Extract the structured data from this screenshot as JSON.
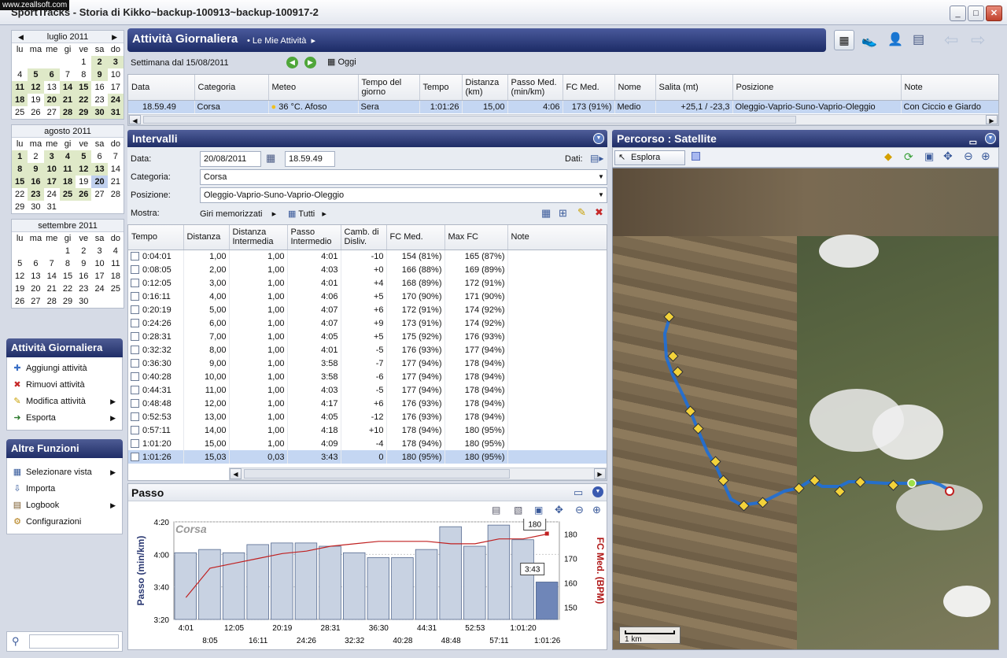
{
  "window": {
    "watermark": "www.zeallsoft.com",
    "title": "SportTracks - Storia di Kikko~backup-100913~backup-100917-2"
  },
  "calendar": {
    "weekdays": [
      "lu",
      "ma",
      "me",
      "gi",
      "ve",
      "sa",
      "do"
    ],
    "months": [
      {
        "name": "luglio 2011",
        "cells": [
          "",
          "",
          "",
          "",
          "1",
          "2",
          "3",
          "4",
          "5",
          "6",
          "7",
          "8",
          "9",
          "10",
          "11",
          "12",
          "13",
          "14",
          "15",
          "16",
          "17",
          "18",
          "19",
          "20",
          "21",
          "22",
          "23",
          "24",
          "25",
          "26",
          "27",
          "28",
          "29",
          "30",
          "31"
        ],
        "marked": [
          "2",
          "3",
          "5",
          "6",
          "9",
          "11",
          "12",
          "14",
          "15",
          "18",
          "20",
          "21",
          "22",
          "24",
          "28",
          "29",
          "30",
          "31"
        ]
      },
      {
        "name": "agosto 2011",
        "cells": [
          "1",
          "2",
          "3",
          "4",
          "5",
          "6",
          "7",
          "8",
          "9",
          "10",
          "11",
          "12",
          "13",
          "14",
          "15",
          "16",
          "17",
          "18",
          "19",
          "20",
          "21",
          "22",
          "23",
          "24",
          "25",
          "26",
          "27",
          "28",
          "29",
          "30",
          "31"
        ],
        "marked": [
          "1",
          "3",
          "4",
          "5",
          "8",
          "9",
          "10",
          "11",
          "12",
          "13",
          "15",
          "16",
          "17",
          "18",
          "23",
          "25",
          "26"
        ],
        "selected": "20"
      },
      {
        "name": "settembre 2011",
        "cells": [
          "",
          "",
          "",
          "1",
          "2",
          "3",
          "4",
          "5",
          "6",
          "7",
          "8",
          "9",
          "10",
          "11",
          "12",
          "13",
          "14",
          "15",
          "16",
          "17",
          "18",
          "19",
          "20",
          "21",
          "22",
          "23",
          "24",
          "25",
          "26",
          "27",
          "28",
          "29",
          "30"
        ],
        "marked": []
      }
    ]
  },
  "tasks": {
    "title": "Attività Giornaliera",
    "items": [
      {
        "icon": "add-icon",
        "glyph": "✚",
        "color": "#3a6fc6",
        "label": "Aggiungi attività",
        "arrow": false
      },
      {
        "icon": "remove-icon",
        "glyph": "✖",
        "color": "#c62828",
        "label": "Rimuovi attività",
        "arrow": false
      },
      {
        "icon": "pencil-icon",
        "glyph": "✎",
        "color": "#c8a000",
        "label": "Modifica attività",
        "arrow": true
      },
      {
        "icon": "export-icon",
        "glyph": "➜",
        "color": "#2d7a2d",
        "label": "Esporta",
        "arrow": true
      }
    ]
  },
  "other": {
    "title": "Altre Funzioni",
    "items": [
      {
        "icon": "view-icon",
        "glyph": "▦",
        "color": "#34589a",
        "label": "Selezionare vista",
        "arrow": true
      },
      {
        "icon": "import-icon",
        "glyph": "⇩",
        "color": "#34589a",
        "label": "Importa",
        "arrow": false
      },
      {
        "icon": "logbook-icon",
        "glyph": "▤",
        "color": "#7a5a2a",
        "label": "Logbook",
        "arrow": true
      },
      {
        "icon": "gear-icon",
        "glyph": "⚙",
        "color": "#b07a10",
        "label": "Configurazioni",
        "arrow": false
      }
    ]
  },
  "header": {
    "title": "Attività Giornaliera",
    "crumb": "Le Mie Attività"
  },
  "week": {
    "label": "Settimana dal 15/08/2011",
    "today": "Oggi"
  },
  "activity": {
    "columns": [
      "Data",
      "Categoria",
      "Meteo",
      "Tempo del giorno",
      "Tempo",
      "Distanza (km)",
      "Passo Med. (min/km)",
      "FC Med.",
      "Nome",
      "Salita (mt)",
      "Posizione",
      "Note"
    ],
    "row": [
      "18.59.49",
      "Corsa",
      "36 °C. Afoso",
      "Sera",
      "1:01:26",
      "15,00",
      "4:06",
      "173 (91%)",
      "Medio",
      "+25,1 / -23,3",
      "Oleggio-Vaprio-Suno-Vaprio-Oleggio",
      "Con Ciccio e Giardo"
    ]
  },
  "intervals": {
    "title": "Intervalli",
    "data_label": "Data:",
    "date": "20/08/2011",
    "time": "18.59.49",
    "dati_label": "Dati:",
    "category_label": "Categoria:",
    "category": "Corsa",
    "position_label": "Posizione:",
    "position": "Oleggio-Vaprio-Suno-Vaprio-Oleggio",
    "show_label": "Mostra:",
    "show_value": "Giri memorizzati",
    "all": "Tutti",
    "columns": [
      "Tempo",
      "Distanza",
      "Distanza Intermedia",
      "Passo Intermedio",
      "Camb. di Disliv.",
      "FC Med.",
      "Max FC",
      "Note"
    ],
    "rows": [
      [
        "0:04:01",
        "1,00",
        "1,00",
        "4:01",
        "-10",
        "154 (81%)",
        "165 (87%)"
      ],
      [
        "0:08:05",
        "2,00",
        "1,00",
        "4:03",
        "+0",
        "166 (88%)",
        "169 (89%)"
      ],
      [
        "0:12:05",
        "3,00",
        "1,00",
        "4:01",
        "+4",
        "168 (89%)",
        "172 (91%)"
      ],
      [
        "0:16:11",
        "4,00",
        "1,00",
        "4:06",
        "+5",
        "170 (90%)",
        "171 (90%)"
      ],
      [
        "0:20:19",
        "5,00",
        "1,00",
        "4:07",
        "+6",
        "172 (91%)",
        "174 (92%)"
      ],
      [
        "0:24:26",
        "6,00",
        "1,00",
        "4:07",
        "+9",
        "173 (91%)",
        "174 (92%)"
      ],
      [
        "0:28:31",
        "7,00",
        "1,00",
        "4:05",
        "+5",
        "175 (92%)",
        "176 (93%)"
      ],
      [
        "0:32:32",
        "8,00",
        "1,00",
        "4:01",
        "-5",
        "176 (93%)",
        "177 (94%)"
      ],
      [
        "0:36:30",
        "9,00",
        "1,00",
        "3:58",
        "-7",
        "177 (94%)",
        "178 (94%)"
      ],
      [
        "0:40:28",
        "10,00",
        "1,00",
        "3:58",
        "-6",
        "177 (94%)",
        "178 (94%)"
      ],
      [
        "0:44:31",
        "11,00",
        "1,00",
        "4:03",
        "-5",
        "177 (94%)",
        "178 (94%)"
      ],
      [
        "0:48:48",
        "12,00",
        "1,00",
        "4:17",
        "+6",
        "176 (93%)",
        "178 (94%)"
      ],
      [
        "0:52:53",
        "13,00",
        "1,00",
        "4:05",
        "-12",
        "176 (93%)",
        "178 (94%)"
      ],
      [
        "0:57:11",
        "14,00",
        "1,00",
        "4:18",
        "+10",
        "178 (94%)",
        "180 (95%)"
      ],
      [
        "1:01:20",
        "15,00",
        "1,00",
        "4:09",
        "-4",
        "178 (94%)",
        "180 (95%)"
      ],
      [
        "1:01:26",
        "15,03",
        "0,03",
        "3:43",
        "0",
        "180 (95%)",
        "180 (95%)"
      ]
    ]
  },
  "passo": {
    "title": "Passo"
  },
  "chart_data": {
    "type": "bar",
    "title": "Corsa",
    "ylabel": "Passo (min/km)",
    "y2label": "FC Med. (BPM)",
    "ylim": [
      "3:20",
      "4:20"
    ],
    "y2lim": [
      145,
      185
    ],
    "yticks": [
      "4:20",
      "4:00",
      "3:40",
      "3:20"
    ],
    "y2ticks": [
      "180",
      "170",
      "160",
      "150"
    ],
    "x_top": [
      "4:01",
      "12:05",
      "20:19",
      "28:31",
      "36:30",
      "44:31",
      "52:53",
      "1:01:20"
    ],
    "x_bottom": [
      "8:05",
      "16:11",
      "24:26",
      "32:32",
      "40:28",
      "48:48",
      "57:11",
      "1:01:26"
    ],
    "categories": [
      "4:01",
      "8:05",
      "12:05",
      "16:11",
      "20:19",
      "24:26",
      "28:31",
      "32:32",
      "36:30",
      "40:28",
      "44:31",
      "48:48",
      "52:53",
      "57:11",
      "1:01:20",
      "1:01:26"
    ],
    "series": [
      {
        "name": "Passo",
        "type": "bar",
        "values": [
          241,
          243,
          241,
          246,
          247,
          247,
          245,
          241,
          238,
          238,
          243,
          257,
          245,
          258,
          249,
          223
        ]
      },
      {
        "name": "FC Med.",
        "type": "line",
        "values": [
          154,
          166,
          168,
          170,
          172,
          173,
          175,
          176,
          177,
          177,
          177,
          176,
          176,
          178,
          178,
          180
        ]
      }
    ],
    "callouts": [
      "180",
      "3:43"
    ],
    "grid": true
  },
  "map": {
    "title": "Percorso  : Satellite",
    "explore": "Esplora",
    "scale": "1 km"
  },
  "colors": {
    "header": "#2a3872",
    "hr_line": "#c02020",
    "bar": "#c8d2e2"
  }
}
